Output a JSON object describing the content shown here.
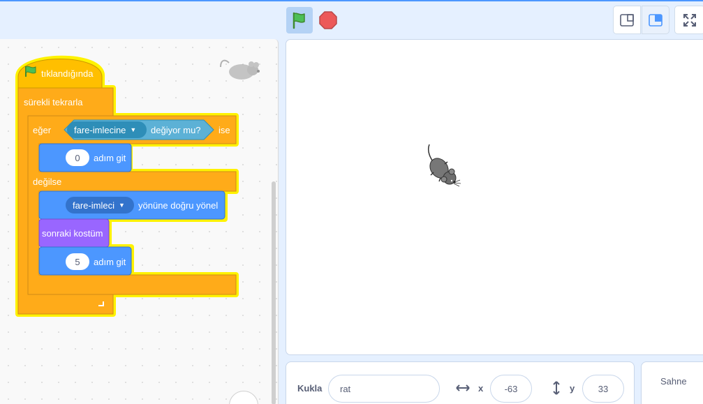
{
  "toolbar": {
    "green_flag_icon": "green-flag-icon",
    "stop_icon": "stop-icon",
    "small_stage_icon": "small-stage-icon",
    "normal_stage_icon": "normal-stage-icon",
    "fullscreen_icon": "fullscreen-icon"
  },
  "colors": {
    "events": "#ffbf00",
    "control": "#ffab19",
    "sensing": "#5cb1d6",
    "motion": "#4c97ff",
    "looks": "#9966ff",
    "highlight": "#fff200",
    "accent": "#4c97ff"
  },
  "script": {
    "hat_label": "tıklandığında",
    "forever_label": "sürekli tekrarla",
    "if_label": "eğer",
    "sensing_menu": "fare-imlecine",
    "sensing_label": "değiyor mu?",
    "then_label": "ise",
    "move1_value": "0",
    "move_label": "adım git",
    "else_label": "değilse",
    "point_menu": "fare-imleci",
    "point_label": "yönüne doğru yönel",
    "next_costume_label": "sonraki kostüm",
    "move2_value": "5",
    "move2_label": "adım git"
  },
  "sprite_info": {
    "sprite_label": "Kukla",
    "sprite_name": "rat",
    "x_label": "x",
    "x_value": "-63",
    "y_label": "y",
    "y_value": "33"
  },
  "stage_panel": {
    "label": "Sahne"
  }
}
